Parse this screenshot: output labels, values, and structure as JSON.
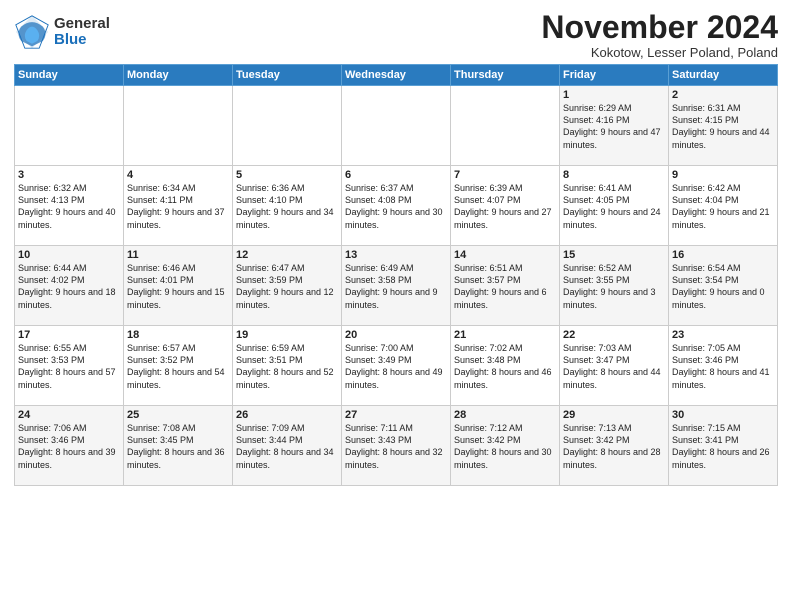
{
  "logo": {
    "general": "General",
    "blue": "Blue"
  },
  "title": "November 2024",
  "location": "Kokotow, Lesser Poland, Poland",
  "headers": [
    "Sunday",
    "Monday",
    "Tuesday",
    "Wednesday",
    "Thursday",
    "Friday",
    "Saturday"
  ],
  "weeks": [
    [
      {
        "day": "",
        "info": ""
      },
      {
        "day": "",
        "info": ""
      },
      {
        "day": "",
        "info": ""
      },
      {
        "day": "",
        "info": ""
      },
      {
        "day": "",
        "info": ""
      },
      {
        "day": "1",
        "info": "Sunrise: 6:29 AM\nSunset: 4:16 PM\nDaylight: 9 hours and 47 minutes."
      },
      {
        "day": "2",
        "info": "Sunrise: 6:31 AM\nSunset: 4:15 PM\nDaylight: 9 hours and 44 minutes."
      }
    ],
    [
      {
        "day": "3",
        "info": "Sunrise: 6:32 AM\nSunset: 4:13 PM\nDaylight: 9 hours and 40 minutes."
      },
      {
        "day": "4",
        "info": "Sunrise: 6:34 AM\nSunset: 4:11 PM\nDaylight: 9 hours and 37 minutes."
      },
      {
        "day": "5",
        "info": "Sunrise: 6:36 AM\nSunset: 4:10 PM\nDaylight: 9 hours and 34 minutes."
      },
      {
        "day": "6",
        "info": "Sunrise: 6:37 AM\nSunset: 4:08 PM\nDaylight: 9 hours and 30 minutes."
      },
      {
        "day": "7",
        "info": "Sunrise: 6:39 AM\nSunset: 4:07 PM\nDaylight: 9 hours and 27 minutes."
      },
      {
        "day": "8",
        "info": "Sunrise: 6:41 AM\nSunset: 4:05 PM\nDaylight: 9 hours and 24 minutes."
      },
      {
        "day": "9",
        "info": "Sunrise: 6:42 AM\nSunset: 4:04 PM\nDaylight: 9 hours and 21 minutes."
      }
    ],
    [
      {
        "day": "10",
        "info": "Sunrise: 6:44 AM\nSunset: 4:02 PM\nDaylight: 9 hours and 18 minutes."
      },
      {
        "day": "11",
        "info": "Sunrise: 6:46 AM\nSunset: 4:01 PM\nDaylight: 9 hours and 15 minutes."
      },
      {
        "day": "12",
        "info": "Sunrise: 6:47 AM\nSunset: 3:59 PM\nDaylight: 9 hours and 12 minutes."
      },
      {
        "day": "13",
        "info": "Sunrise: 6:49 AM\nSunset: 3:58 PM\nDaylight: 9 hours and 9 minutes."
      },
      {
        "day": "14",
        "info": "Sunrise: 6:51 AM\nSunset: 3:57 PM\nDaylight: 9 hours and 6 minutes."
      },
      {
        "day": "15",
        "info": "Sunrise: 6:52 AM\nSunset: 3:55 PM\nDaylight: 9 hours and 3 minutes."
      },
      {
        "day": "16",
        "info": "Sunrise: 6:54 AM\nSunset: 3:54 PM\nDaylight: 9 hours and 0 minutes."
      }
    ],
    [
      {
        "day": "17",
        "info": "Sunrise: 6:55 AM\nSunset: 3:53 PM\nDaylight: 8 hours and 57 minutes."
      },
      {
        "day": "18",
        "info": "Sunrise: 6:57 AM\nSunset: 3:52 PM\nDaylight: 8 hours and 54 minutes."
      },
      {
        "day": "19",
        "info": "Sunrise: 6:59 AM\nSunset: 3:51 PM\nDaylight: 8 hours and 52 minutes."
      },
      {
        "day": "20",
        "info": "Sunrise: 7:00 AM\nSunset: 3:49 PM\nDaylight: 8 hours and 49 minutes."
      },
      {
        "day": "21",
        "info": "Sunrise: 7:02 AM\nSunset: 3:48 PM\nDaylight: 8 hours and 46 minutes."
      },
      {
        "day": "22",
        "info": "Sunrise: 7:03 AM\nSunset: 3:47 PM\nDaylight: 8 hours and 44 minutes."
      },
      {
        "day": "23",
        "info": "Sunrise: 7:05 AM\nSunset: 3:46 PM\nDaylight: 8 hours and 41 minutes."
      }
    ],
    [
      {
        "day": "24",
        "info": "Sunrise: 7:06 AM\nSunset: 3:46 PM\nDaylight: 8 hours and 39 minutes."
      },
      {
        "day": "25",
        "info": "Sunrise: 7:08 AM\nSunset: 3:45 PM\nDaylight: 8 hours and 36 minutes."
      },
      {
        "day": "26",
        "info": "Sunrise: 7:09 AM\nSunset: 3:44 PM\nDaylight: 8 hours and 34 minutes."
      },
      {
        "day": "27",
        "info": "Sunrise: 7:11 AM\nSunset: 3:43 PM\nDaylight: 8 hours and 32 minutes."
      },
      {
        "day": "28",
        "info": "Sunrise: 7:12 AM\nSunset: 3:42 PM\nDaylight: 8 hours and 30 minutes."
      },
      {
        "day": "29",
        "info": "Sunrise: 7:13 AM\nSunset: 3:42 PM\nDaylight: 8 hours and 28 minutes."
      },
      {
        "day": "30",
        "info": "Sunrise: 7:15 AM\nSunset: 3:41 PM\nDaylight: 8 hours and 26 minutes."
      }
    ]
  ]
}
